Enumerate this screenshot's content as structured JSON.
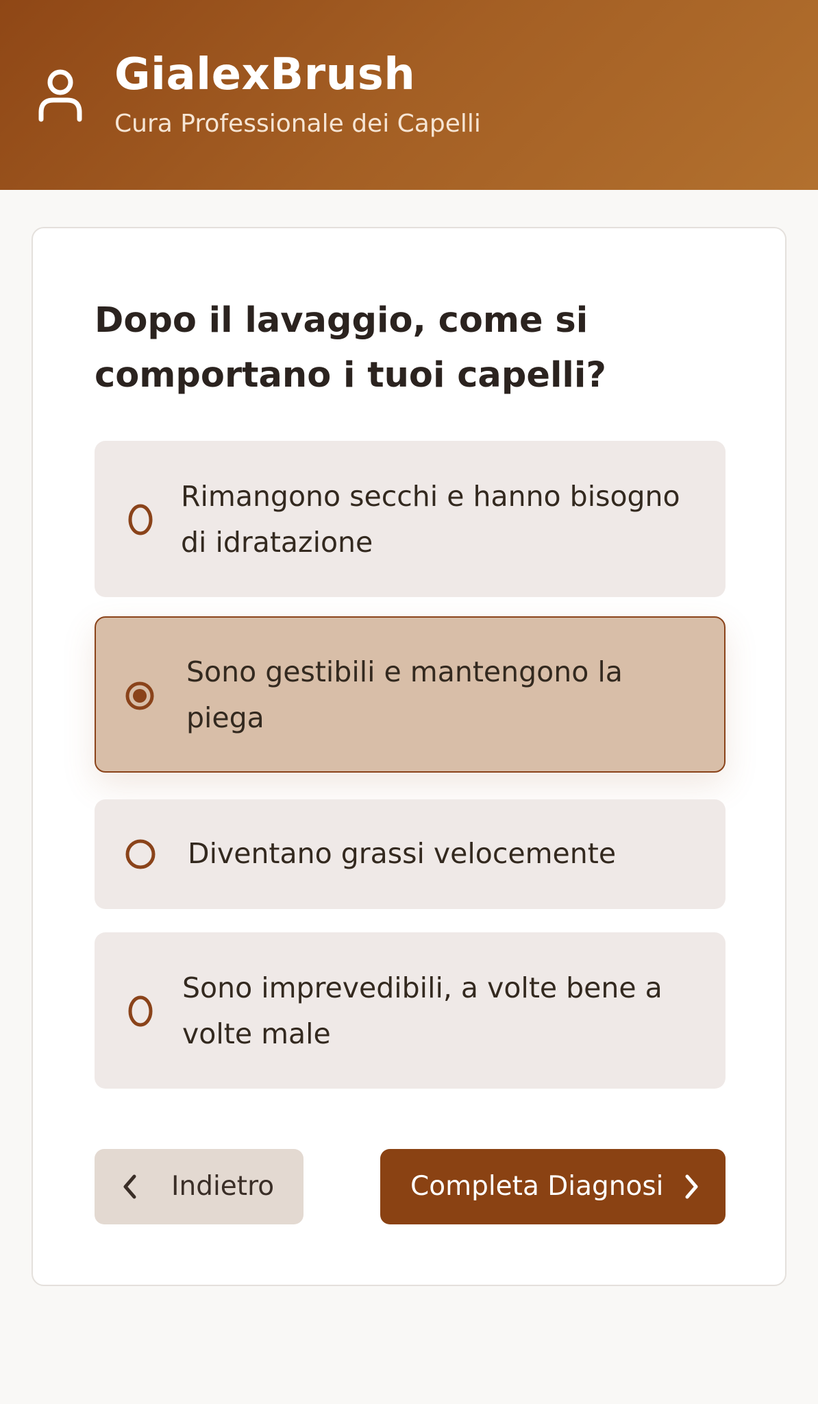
{
  "header": {
    "title": "GialexBrush",
    "subtitle": "Cura Professionale dei Capelli",
    "icon": "user-icon"
  },
  "quiz": {
    "question": "Dopo il lavaggio, come si comportano i tuoi capelli?",
    "options": [
      {
        "label": "Rimangono secchi e hanno bisogno di idratazione",
        "selected": false
      },
      {
        "label": "Sono gestibili e mantengono la piega",
        "selected": true
      },
      {
        "label": "Diventano grassi velocemente",
        "selected": false
      },
      {
        "label": "Sono imprevedibili, a volte bene a volte male",
        "selected": false
      }
    ],
    "back_label": "Indietro",
    "next_label": "Completa Diagnosi"
  },
  "colors": {
    "brand": "#8a4213",
    "selected_bg": "#d8bea8",
    "option_bg": "#efe9e7"
  }
}
